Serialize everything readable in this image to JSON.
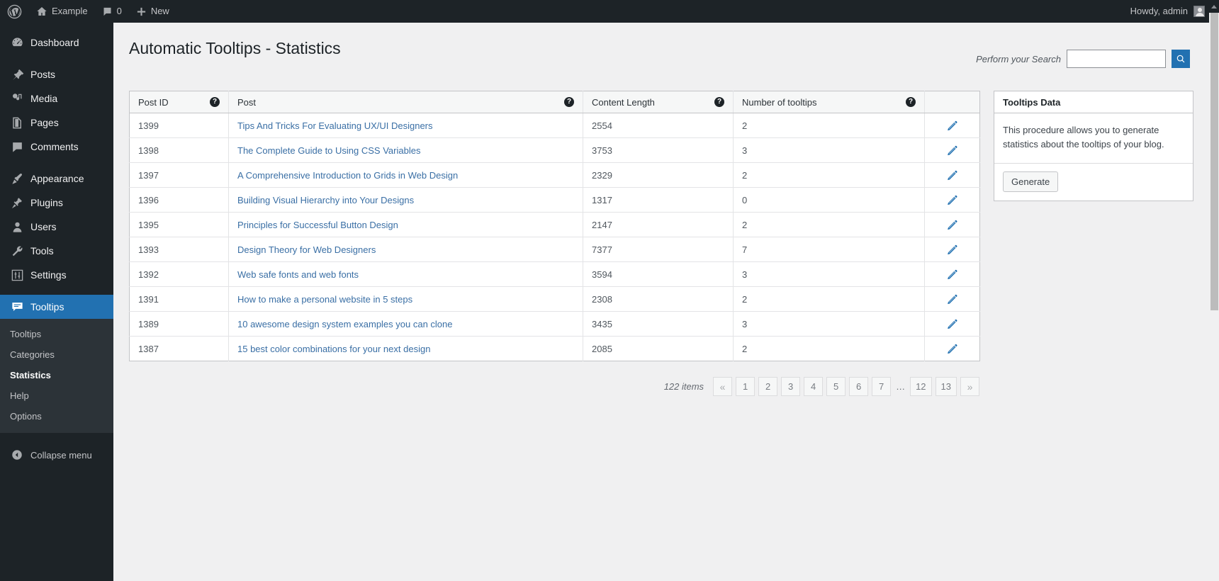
{
  "adminbar": {
    "logo_icon": "wordpress-logo-icon",
    "site_name": "Example",
    "comments_icon": "comment-bubble-icon",
    "comments_count": "0",
    "new_icon": "plus-icon",
    "new_label": "New",
    "howdy": "Howdy, admin",
    "avatar_icon": "avatar-icon"
  },
  "sidebar": {
    "items": [
      {
        "label": "Dashboard",
        "icon": "dashboard-icon"
      },
      {
        "label": "Posts",
        "icon": "pin-icon"
      },
      {
        "label": "Media",
        "icon": "media-icon"
      },
      {
        "label": "Pages",
        "icon": "page-icon"
      },
      {
        "label": "Comments",
        "icon": "comment-bubble-icon"
      },
      {
        "label": "Appearance",
        "icon": "paintbrush-icon"
      },
      {
        "label": "Plugins",
        "icon": "plug-icon"
      },
      {
        "label": "Users",
        "icon": "user-icon"
      },
      {
        "label": "Tools",
        "icon": "wrench-icon"
      },
      {
        "label": "Settings",
        "icon": "sliders-icon"
      },
      {
        "label": "Tooltips",
        "icon": "tooltip-icon"
      }
    ],
    "submenu": [
      {
        "label": "Tooltips"
      },
      {
        "label": "Categories"
      },
      {
        "label": "Statistics"
      },
      {
        "label": "Help"
      },
      {
        "label": "Options"
      }
    ],
    "collapse_label": "Collapse menu",
    "collapse_icon": "chevron-left-circle-icon",
    "active_color": "#2271b1"
  },
  "header": {
    "title": "Automatic Tooltips - Statistics",
    "search_label": "Perform your Search",
    "search_value": "",
    "search_placeholder": "",
    "search_icon": "search-icon"
  },
  "table": {
    "columns": [
      {
        "label": "Post ID",
        "help": "?"
      },
      {
        "label": "Post",
        "help": "?"
      },
      {
        "label": "Content Length",
        "help": "?"
      },
      {
        "label": "Number of tooltips",
        "help": "?"
      },
      {
        "label": ""
      }
    ],
    "rows": [
      {
        "id": "1399",
        "post": "Tips And Tricks For Evaluating UX/UI Designers",
        "length": "2554",
        "tooltips": "2",
        "edit_icon": "pencil-icon"
      },
      {
        "id": "1398",
        "post": "The Complete Guide to Using CSS Variables",
        "length": "3753",
        "tooltips": "3",
        "edit_icon": "pencil-icon"
      },
      {
        "id": "1397",
        "post": "A Comprehensive Introduction to Grids in Web Design",
        "length": "2329",
        "tooltips": "2",
        "edit_icon": "pencil-icon"
      },
      {
        "id": "1396",
        "post": "Building Visual Hierarchy into Your Designs",
        "length": "1317",
        "tooltips": "0",
        "edit_icon": "pencil-icon"
      },
      {
        "id": "1395",
        "post": "Principles for Successful Button Design",
        "length": "2147",
        "tooltips": "2",
        "edit_icon": "pencil-icon"
      },
      {
        "id": "1393",
        "post": "Design Theory for Web Designers",
        "length": "7377",
        "tooltips": "7",
        "edit_icon": "pencil-icon"
      },
      {
        "id": "1392",
        "post": "Web safe fonts and web fonts",
        "length": "3594",
        "tooltips": "3",
        "edit_icon": "pencil-icon"
      },
      {
        "id": "1391",
        "post": "How to make a personal website in 5 steps",
        "length": "2308",
        "tooltips": "2",
        "edit_icon": "pencil-icon"
      },
      {
        "id": "1389",
        "post": "10 awesome design system examples you can clone",
        "length": "3435",
        "tooltips": "3",
        "edit_icon": "pencil-icon"
      },
      {
        "id": "1387",
        "post": "15 best color combinations for your next design",
        "length": "2085",
        "tooltips": "2",
        "edit_icon": "pencil-icon"
      }
    ]
  },
  "pagination": {
    "items_label": "122 items",
    "prev": "«",
    "pages": [
      "1",
      "2",
      "3",
      "4",
      "5",
      "6",
      "7"
    ],
    "dots": "…",
    "tail_pages": [
      "12",
      "13"
    ],
    "next": "»"
  },
  "sidebox": {
    "title": "Tooltips Data",
    "description": "This procedure allows you to generate statistics about the tooltips of your blog.",
    "button_label": "Generate"
  }
}
